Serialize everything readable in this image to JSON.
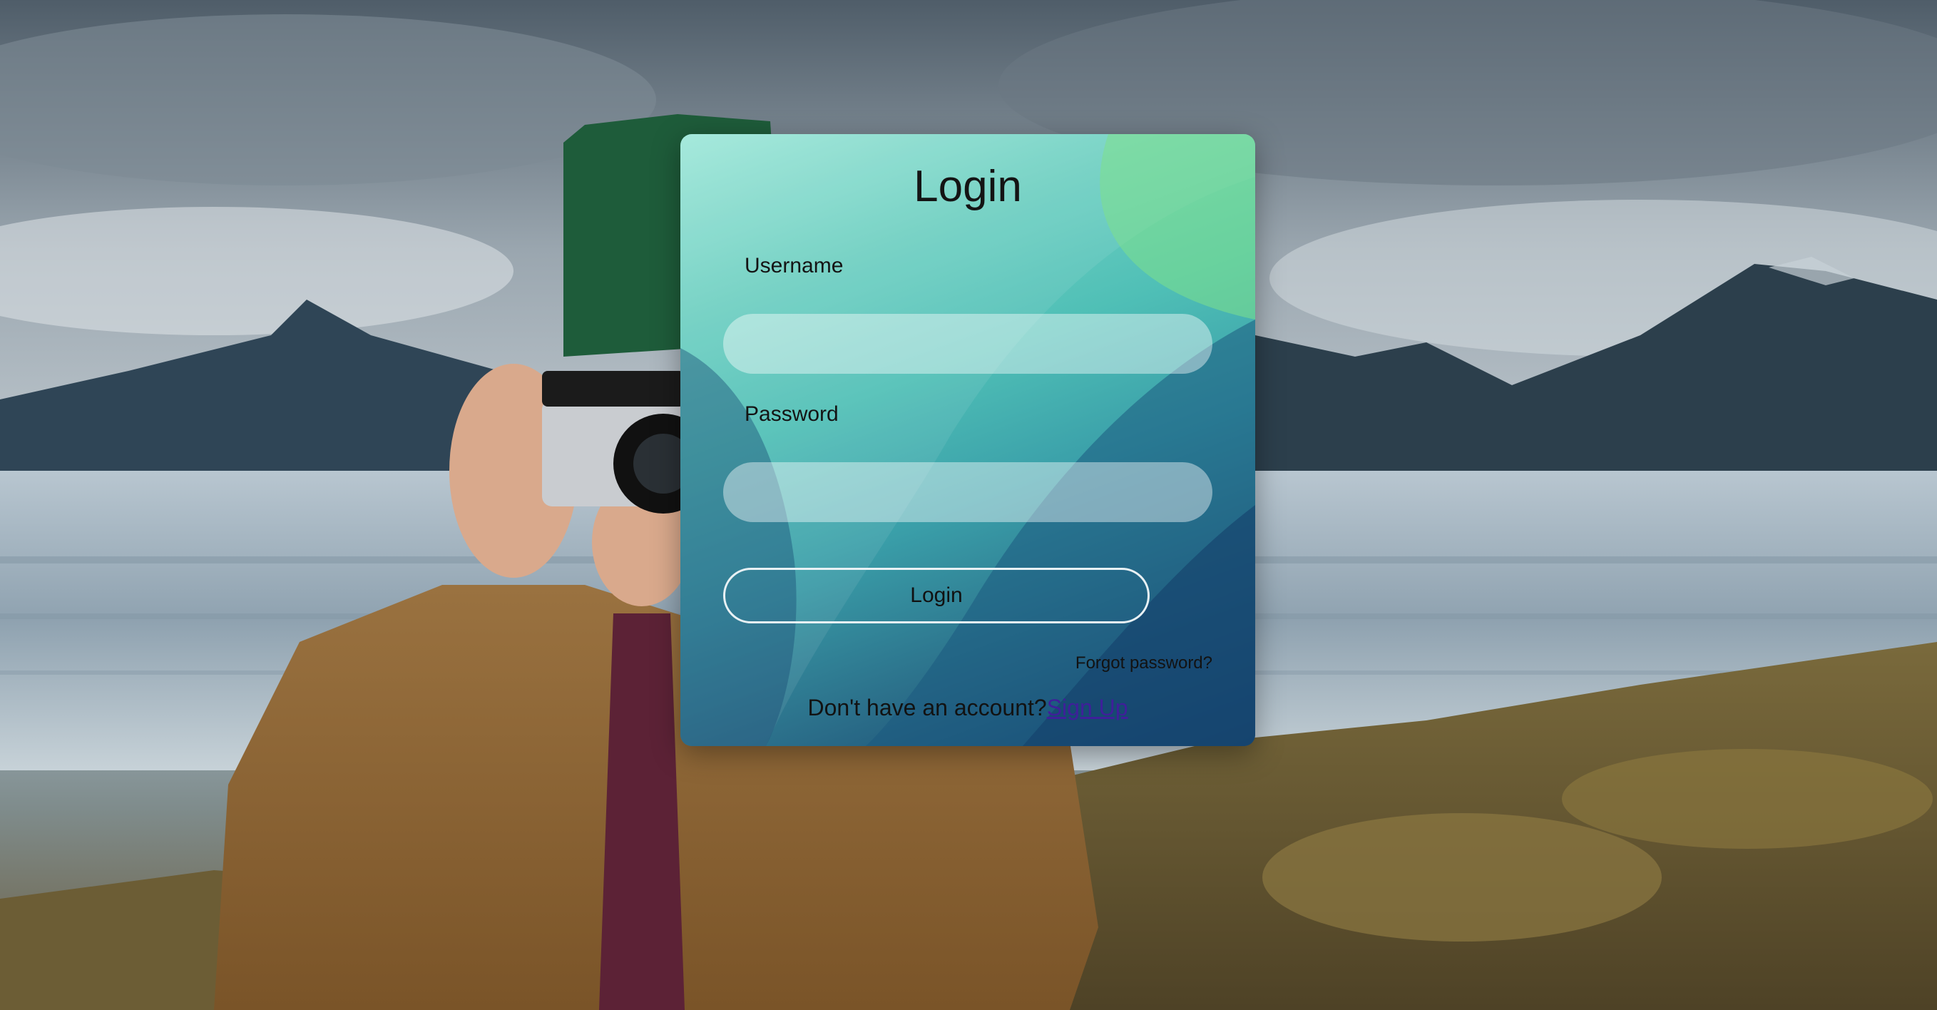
{
  "login_card": {
    "title": "Login",
    "username_label": "Username",
    "username_value": "",
    "password_label": "Password",
    "password_value": "",
    "login_button_label": "Login",
    "forgot_password_link": "Forgot password?",
    "signup_prompt": "Don't have an account?",
    "signup_link": "Sign Up"
  },
  "theme": {
    "card_gradient_top": "#9fe7d9",
    "card_gradient_bottom": "#153d6a",
    "link_color": "#3f1f9a"
  }
}
